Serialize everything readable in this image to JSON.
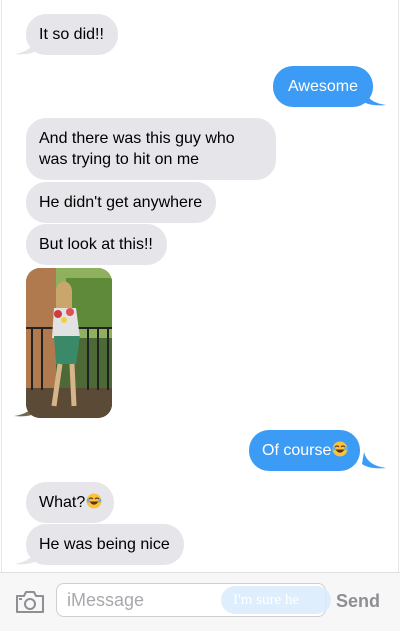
{
  "conversation": {
    "messages": [
      {
        "from": "them",
        "text": "It so did!!"
      },
      {
        "from": "me",
        "text": "Awesome"
      },
      {
        "from": "them",
        "text": "And there was this guy who was trying to hit on me"
      },
      {
        "from": "them",
        "text": "He didn't get anywhere"
      },
      {
        "from": "them",
        "text": "But look at this!!"
      },
      {
        "from": "them",
        "type": "photo"
      },
      {
        "from": "me",
        "text": "Of course",
        "emoji": "laughing-crying-emoji"
      },
      {
        "from": "them",
        "text": "What?",
        "emoji": "laughing-crying-emoji"
      },
      {
        "from": "them",
        "text": "He was being nice"
      }
    ]
  },
  "input_bar": {
    "camera_icon": "camera-icon",
    "placeholder": "iMessage",
    "ghost_text": "I'm sure he",
    "send_label": "Send"
  },
  "colors": {
    "sent_bubble": "#3c9bf5",
    "received_bubble": "#e5e5ea",
    "send_text": "#8e8e93"
  }
}
